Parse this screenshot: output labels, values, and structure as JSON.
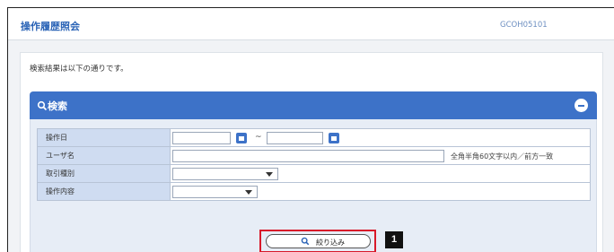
{
  "header": {
    "title": "操作履歴照会",
    "screen_id": "GCOH05101"
  },
  "message": "検索結果は以下の通りです。",
  "search_panel": {
    "title": "検索",
    "rows": [
      {
        "label": "操作日",
        "range_separator": "~"
      },
      {
        "label": "ユーザ名",
        "hint": "全角半角60文字以内／前方一致"
      },
      {
        "label": "取引種別"
      },
      {
        "label": "操作内容"
      }
    ],
    "filter_button_label": "絞り込み",
    "callout_number": "1"
  },
  "colors": {
    "accent": "#3d72c8",
    "highlight": "#d8192a",
    "title": "#2a63b6"
  }
}
